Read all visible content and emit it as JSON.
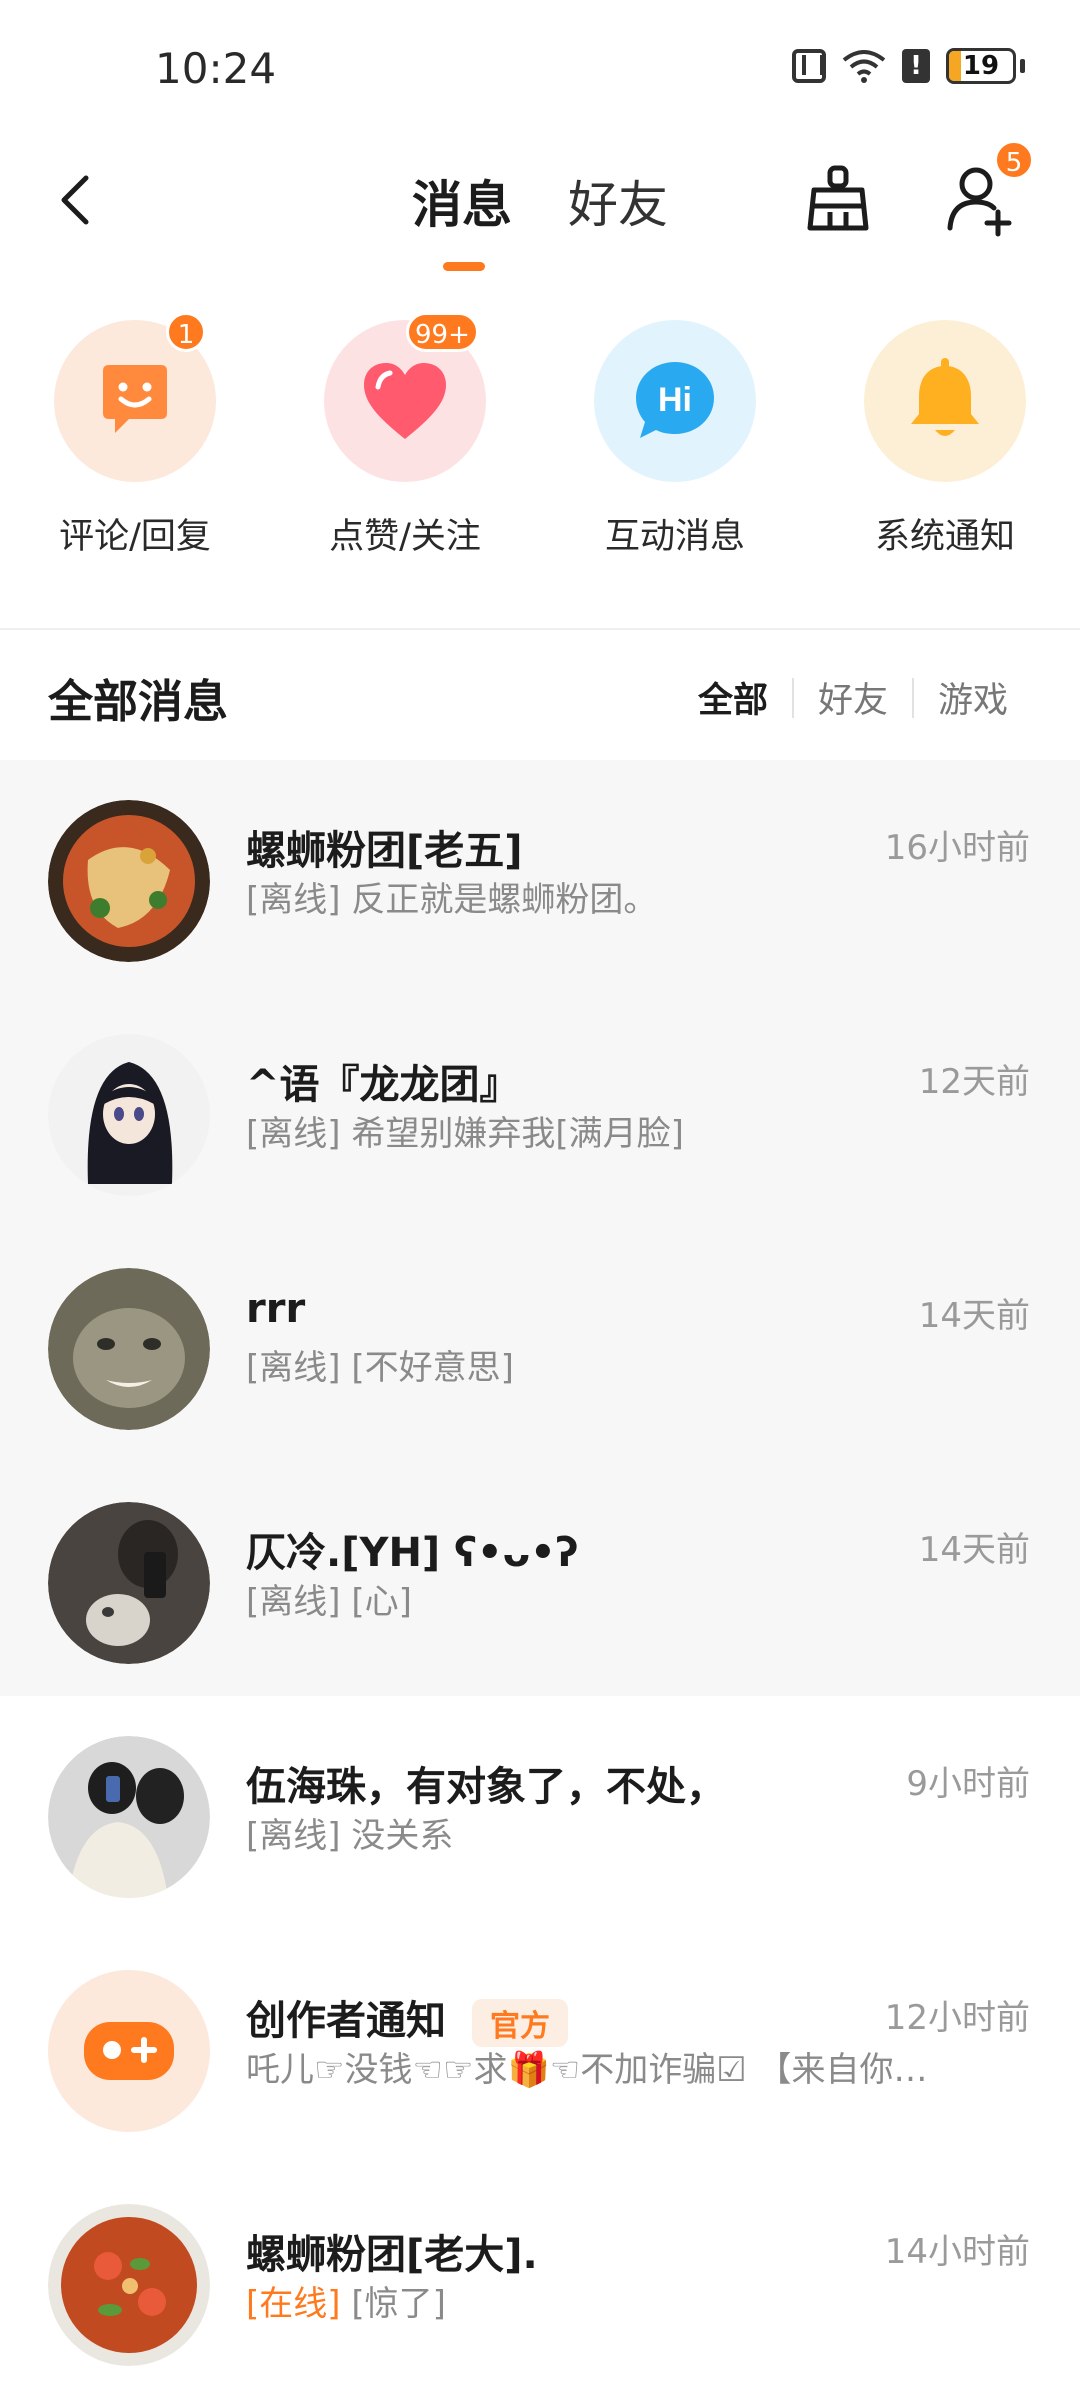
{
  "status_bar": {
    "time": "10:24",
    "battery": "19",
    "battery_level": 0.19
  },
  "header": {
    "tab_messages": "消息",
    "tab_friends": "好友",
    "friend_request_badge": "5"
  },
  "quick_entries": [
    {
      "label": "评论/回复",
      "badge": "1",
      "icon": "chat-smile-icon",
      "bg": "#fde8dc",
      "fg": "#ff8a3d"
    },
    {
      "label": "点赞/关注",
      "badge": "99+",
      "icon": "heart-icon",
      "bg": "#fde2e4",
      "fg": "#ff5a6e"
    },
    {
      "label": "互动消息",
      "badge": "",
      "icon": "hi-bubble-icon",
      "bg": "#e1f3fd",
      "fg": "#29aaf0"
    },
    {
      "label": "系统通知",
      "badge": "",
      "icon": "bell-icon",
      "bg": "#fdefd6",
      "fg": "#ffb020"
    }
  ],
  "section": {
    "title": "全部消息",
    "filters": [
      "全部",
      "好友",
      "游戏"
    ]
  },
  "messages": [
    {
      "name": "螺蛳粉团[老五]",
      "status": "[离线]",
      "text": "反正就是螺蛳粉团。",
      "time": "16小时前"
    },
    {
      "name": "^语『龙龙团』",
      "status": "[离线]",
      "text": "希望别嫌弃我[满月脸]",
      "time": "12天前"
    },
    {
      "name": "rrr",
      "status": "[离线]",
      "text": "[不好意思]",
      "time": "14天前"
    },
    {
      "name": "仄冷.[YH] ʕ•ᴗ•ʔ",
      "status": "[离线]",
      "text": "[心]",
      "time": "14天前"
    },
    {
      "name": "伍海珠，有对象了，不处，",
      "status": "[离线]",
      "text": "没关系",
      "time": "9小时前"
    },
    {
      "name": "创作者通知",
      "tag": "官方",
      "status": "",
      "text": "吒儿☞没钱☜☞求🎁☜不加诈骗☑ 【来自你…",
      "time": "12小时前"
    },
    {
      "name": "螺蛳粉团[老大].",
      "status": "[在线]",
      "text": "[惊了]",
      "time": "14小时前"
    }
  ]
}
